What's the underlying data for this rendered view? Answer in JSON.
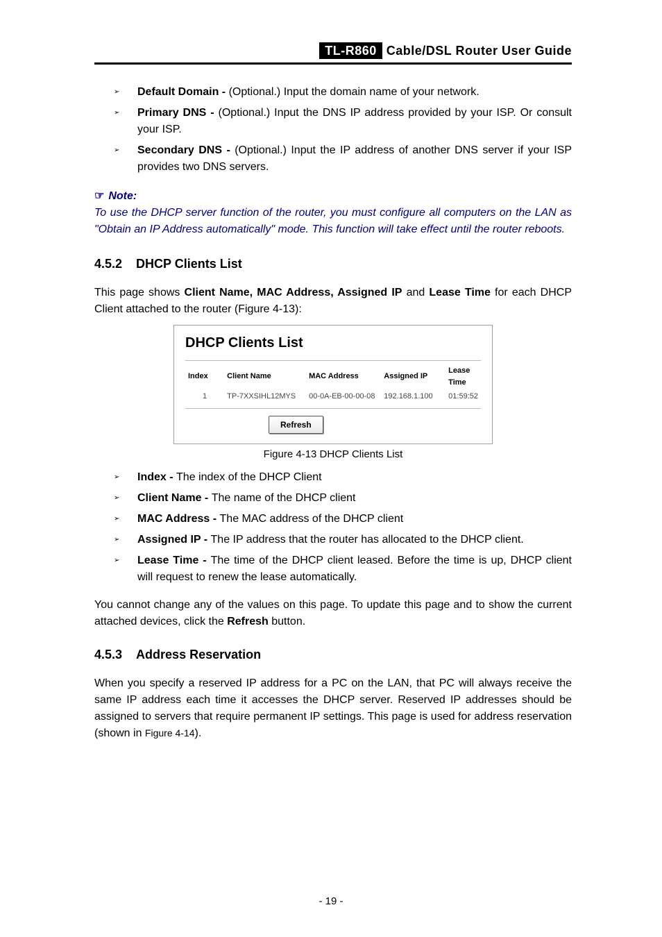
{
  "header": {
    "model": "TL-R860",
    "title_rest": "Cable/DSL  Router  User  Guide"
  },
  "top_list": [
    {
      "term": "Default Domain - ",
      "desc": "(Optional.) Input the domain name of your network."
    },
    {
      "term": "Primary DNS - ",
      "desc": "(Optional.) Input the DNS IP address provided by your ISP. Or consult your ISP."
    },
    {
      "term": "Secondary DNS - ",
      "desc": "(Optional.) Input the IP address of another DNS server if your ISP provides two DNS servers."
    }
  ],
  "note": {
    "hand": "☞",
    "label": "Note:",
    "text": "To use the DHCP server function of the router, you must configure all computers on the LAN as \"Obtain an IP Address automatically\" mode. This function will take effect until the router reboots."
  },
  "sec452": {
    "num": "4.5.2",
    "title": "DHCP Clients List",
    "intro_pre": "This page shows ",
    "intro_bold": "Client Name, MAC Address, Assigned IP",
    "intro_mid": " and ",
    "intro_bold2": "Lease Time",
    "intro_post": " for each DHCP Client attached to the router (Figure 4-13):"
  },
  "figure": {
    "title": "DHCP Clients List",
    "cols": [
      "Index",
      "Client Name",
      "MAC Address",
      "Assigned IP",
      "Lease Time"
    ],
    "row": {
      "index": "1",
      "client": "TP-7XXSIHL12MYS",
      "mac": "00-0A-EB-00-00-08",
      "ip": "192.168.1.100",
      "lease": "01:59:52"
    },
    "refresh": "Refresh",
    "caption": "Figure 4-13 DHCP Clients List"
  },
  "fields_list": [
    {
      "term": "Index - ",
      "desc": "The index of the DHCP Client"
    },
    {
      "term": "Client Name - ",
      "desc": "The name of the DHCP client"
    },
    {
      "term": "MAC Address - ",
      "desc": "The MAC address of the DHCP client"
    },
    {
      "term": "Assigned IP - ",
      "desc": "The IP address that the router has allocated to the DHCP client."
    },
    {
      "term": "Lease Time - ",
      "desc": "The time of the DHCP client leased. Before the time is up, DHCP client will request to renew the lease automatically."
    }
  ],
  "update_para_pre": "You cannot change any of the values on this page. To update this page and to show the current attached devices, click the ",
  "update_para_bold": "Refresh",
  "update_para_post": " button.",
  "sec453": {
    "num": "4.5.3",
    "title": "Address Reservation",
    "para_pre": "When you specify a reserved IP address for a PC on the LAN, that PC will always receive the same IP address each time it accesses the DHCP server. Reserved IP addresses should be assigned to servers that require permanent IP settings. This page is used for address reservation (shown in ",
    "fig_ref": "Figure 4-14",
    "para_post": ")."
  },
  "page_number": "- 19 -"
}
